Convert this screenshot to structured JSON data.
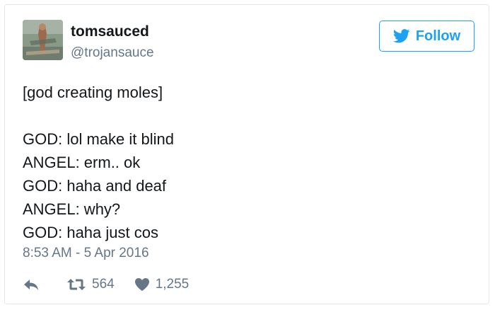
{
  "user": {
    "name": "tomsauced",
    "handle": "@trojansauce"
  },
  "follow_button": {
    "label": "Follow"
  },
  "tweet": {
    "lines": [
      "[god creating moles]",
      "",
      "GOD: lol make it blind",
      "ANGEL: erm.. ok",
      "GOD: haha and deaf",
      "ANGEL: why?",
      "GOD: haha just cos"
    ],
    "timestamp": "8:53 AM - 5 Apr 2016"
  },
  "actions": {
    "retweet_count": "564",
    "like_count": "1,255"
  },
  "colors": {
    "accent": "#1da1f2",
    "text": "#14171a",
    "muted": "#657786",
    "border": "#e1e8ed"
  },
  "icons": [
    "avatar-image",
    "twitter-bird-icon",
    "reply-icon",
    "retweet-icon",
    "heart-icon"
  ]
}
